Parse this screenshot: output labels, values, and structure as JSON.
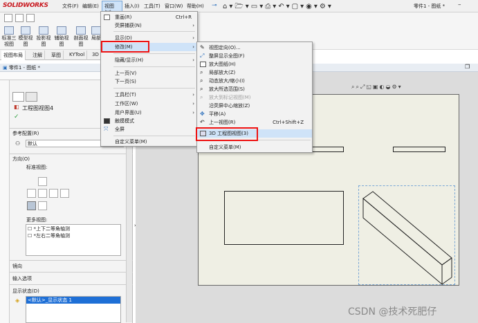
{
  "app": {
    "logo": "SOLIDWORKS",
    "doc_title": "零件1 - 图纸 *"
  },
  "menubar": {
    "file": "文件(F)",
    "edit": "编辑(E)",
    "view": "视图(V)",
    "insert": "插入(I)",
    "tools": "工具(T)",
    "window": "窗口(W)",
    "help": "帮助(H)"
  },
  "commandmanager": {
    "tools": [
      {
        "label": "标准三视图"
      },
      {
        "label": "模型视图"
      },
      {
        "label": "投影视图"
      },
      {
        "label": "辅助视图"
      },
      {
        "label": "剖面视图"
      },
      {
        "label": "局部"
      }
    ]
  },
  "tabs": [
    "视图布局",
    "注解",
    "草图",
    "KYTool",
    "3D"
  ],
  "doc_tab": "零件1 - 图纸 *",
  "pm": {
    "title": "工程图视图4",
    "ref_config_header": "参考配置(R)",
    "ref_config_value": "默认",
    "orientation_header": "方向(O)",
    "standard_views": "标准视图:",
    "more_views": "更多视图:",
    "more_views_items": [
      "*上下二等角轴测",
      "*左右二等角轴测"
    ],
    "mirror_header": "镜向",
    "import_header": "输入选项",
    "display_state_header": "显示状态(D)",
    "display_state_value": "<默认>_显示状态 1"
  },
  "view_menu": {
    "items": [
      {
        "label": "重画(R)",
        "shortcut": "Ctrl+R",
        "icon": "redraw-icon"
      },
      {
        "label": "荧屏捕获(N)",
        "arrow": "›"
      },
      {
        "label": "显示(D)",
        "arrow": "›"
      },
      {
        "label": "修改(M)",
        "arrow": "›"
      },
      {
        "label": "隐藏/显示(H)",
        "arrow": "›"
      },
      {
        "label": "上一页(V)"
      },
      {
        "label": "下一页(S)"
      },
      {
        "label": "工具栏(T)",
        "arrow": "›"
      },
      {
        "label": "工作区(W)",
        "arrow": "›"
      },
      {
        "label": "用户界面(U)",
        "arrow": "›"
      },
      {
        "label": "触摸模式",
        "icon": "touch-icon"
      },
      {
        "label": "全屏",
        "icon": "fullscreen-icon"
      },
      {
        "label": "自定义菜单(M)"
      }
    ]
  },
  "modify_menu": {
    "items": [
      {
        "label": "视图定向(O)..."
      },
      {
        "label": "整屏显示全图(F)"
      },
      {
        "label": "放大图纸(H)"
      },
      {
        "label": "局部放大(Z)"
      },
      {
        "label": "动态放大/缩小(I)"
      },
      {
        "label": "放大所选范围(S)"
      },
      {
        "label": "放大到标记视图(M)",
        "disabled": true
      },
      {
        "label": "沿荧屏中心缩放(Z)"
      },
      {
        "label": "平移(A)"
      },
      {
        "label": "上一视图(R)",
        "shortcut": "Ctrl+Shift+Z"
      },
      {
        "label": "3D 工程图视图(3)"
      },
      {
        "label": "自定义菜单(M)"
      }
    ]
  },
  "watermark": "CSDN @技术死肥仔"
}
